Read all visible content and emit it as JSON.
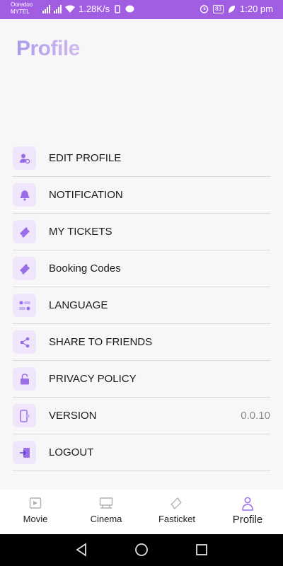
{
  "status_bar": {
    "carrier_top": "Ooredoo",
    "carrier_bottom": "MYTEL",
    "speed": "1.28K/s",
    "battery": "83",
    "time": "1:20 pm"
  },
  "header": {
    "title": "Profile"
  },
  "menu": {
    "items": [
      {
        "label": "EDIT PROFILE",
        "icon": "edit-profile-icon"
      },
      {
        "label": "NOTIFICATION",
        "icon": "bell-icon"
      },
      {
        "label": "MY TICKETS",
        "icon": "ticket-icon"
      },
      {
        "label": "Booking Codes",
        "icon": "ticket-icon"
      },
      {
        "label": "LANGUAGE",
        "icon": "language-icon"
      },
      {
        "label": "SHARE TO FRIENDS",
        "icon": "share-icon"
      },
      {
        "label": "PRIVACY POLICY",
        "icon": "lock-icon"
      },
      {
        "label": "VERSION",
        "icon": "phone-icon",
        "value": "0.0.10"
      },
      {
        "label": "LOGOUT",
        "icon": "logout-icon"
      }
    ]
  },
  "bottom_nav": {
    "items": [
      {
        "label": "Movie",
        "icon": "movie-icon"
      },
      {
        "label": "Cinema",
        "icon": "cinema-icon"
      },
      {
        "label": "Fasticket",
        "icon": "fasticket-icon"
      },
      {
        "label": "Profile",
        "icon": "profile-icon",
        "active": true
      }
    ]
  },
  "colors": {
    "accent": "#a15ee3",
    "icon_bg": "#efe6fb",
    "icon": "#9a6ee8"
  }
}
